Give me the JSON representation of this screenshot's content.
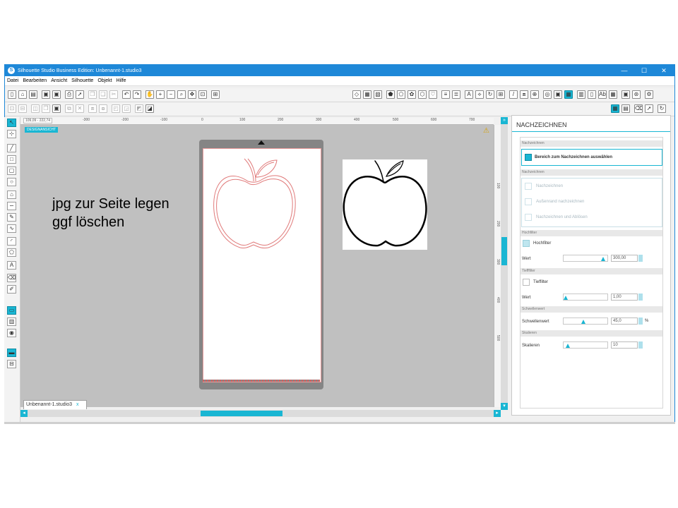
{
  "window": {
    "title": "Silhouette Studio Business Edition: Unbenannt-1.studio3",
    "minimize": "—",
    "maximize": "☐",
    "close": "✕",
    "logo": "S"
  },
  "menu": [
    "Datei",
    "Bearbeiten",
    "Ansicht",
    "Silhouette",
    "Objekt",
    "Hilfe"
  ],
  "canvas": {
    "coords": "109,09 - 222,74",
    "design_label": "DESIGNANSICHT",
    "ruler_top": [
      "-300",
      "-200",
      "-100",
      "0",
      "100",
      "200",
      "300",
      "400",
      "500",
      "600",
      "700"
    ],
    "ruler_right": [
      "100",
      "200",
      "300",
      "400",
      "500"
    ],
    "tab_label": "Unbenannt-1.studio3",
    "tab_close": "x",
    "warning_icon": "⚠"
  },
  "overlay_text": {
    "line1": "jpg zur Seite legen",
    "line2": "ggf löschen"
  },
  "panel": {
    "title": "NACHZEICHNEN",
    "sec_area": "Nachzeichnen",
    "area_button": "Bereich zum Nachzeichnen auswählen",
    "sec_trace": "Nachzeichnen",
    "opt_trace": "Nachzeichnen",
    "opt_outer": "Außenrand nachzeichnen",
    "opt_detach": "Nachzeichnen und Ablösen",
    "sec_highpass": "Hochfilter",
    "highpass_label": "Hochfilter",
    "highpass_checked": true,
    "highpass_value_label": "Wert",
    "highpass_value": "300,00",
    "highpass_level": 0.95,
    "sec_lowpass": "Tiefffilter",
    "lowpass_label": "Tieffilter",
    "lowpass_value_label": "Wert",
    "lowpass_value": "1,00",
    "lowpass_level": 0.0,
    "sec_threshold": "Schwellenwert",
    "threshold_label": "Schwellenwert",
    "threshold_value": "45,0",
    "threshold_unit": "%",
    "threshold_level": 0.45,
    "sec_scale": "Skalieren",
    "scale_label": "Skalieren",
    "scale_value": "10",
    "scale_level": 0.05
  },
  "colors": {
    "accent": "#19b6d3",
    "titlebar": "#1e88d8",
    "canvas": "#c0c0c0"
  }
}
